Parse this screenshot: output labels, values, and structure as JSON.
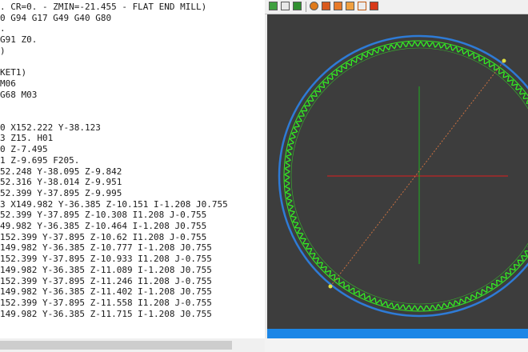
{
  "editor": {
    "lines": [
      ". CR=0. - ZMIN=-21.455 - FLAT END MILL)",
      "0 G94 G17 G49 G40 G80",
      ".",
      "G91 Z0.",
      ")",
      "",
      "KET1)",
      "M06",
      "G68 M03",
      "",
      "",
      "0 X152.222 Y-38.123",
      "3 Z15. H01",
      "0 Z-7.495",
      "1 Z-9.695 F205.",
      "52.248 Y-38.095 Z-9.842",
      "52.316 Y-38.014 Z-9.951",
      "52.399 Y-37.895 Z-9.995",
      "3 X149.982 Y-36.385 Z-10.151 I-1.208 J0.755",
      "52.399 Y-37.895 Z-10.308 I1.208 J-0.755",
      "49.982 Y-36.385 Z-10.464 I-1.208 J0.755",
      "152.399 Y-37.895 Z-10.62 I1.208 J-0.755",
      "149.982 Y-36.385 Z-10.777 I-1.208 J0.755",
      "152.399 Y-37.895 Z-10.933 I1.208 J-0.755",
      "149.982 Y-36.385 Z-11.089 I-1.208 J0.755",
      "152.399 Y-37.895 Z-11.246 I1.208 J-0.755",
      "149.982 Y-36.385 Z-11.402 I-1.208 J0.755",
      "152.399 Y-37.895 Z-11.558 I1.208 J-0.755",
      "149.982 Y-36.385 Z-11.715 I-1.208 J0.755"
    ]
  },
  "toolbar": {
    "buttons": [
      "toolpath-icon",
      "tree-icon",
      "lightning-icon",
      "stop-icon",
      "grid-icon",
      "reset-icon",
      "doc-icon",
      "stock-icon",
      "save-icon"
    ]
  },
  "colors": {
    "viewport_bg": "#3d3d3d",
    "toolpath": "#33ee22",
    "outer_circle": "#2e7bd6",
    "axis_x": "#e02020",
    "axis_y": "#20b020",
    "diagonal": "#c87040",
    "status_bar": "#1c86e6"
  }
}
